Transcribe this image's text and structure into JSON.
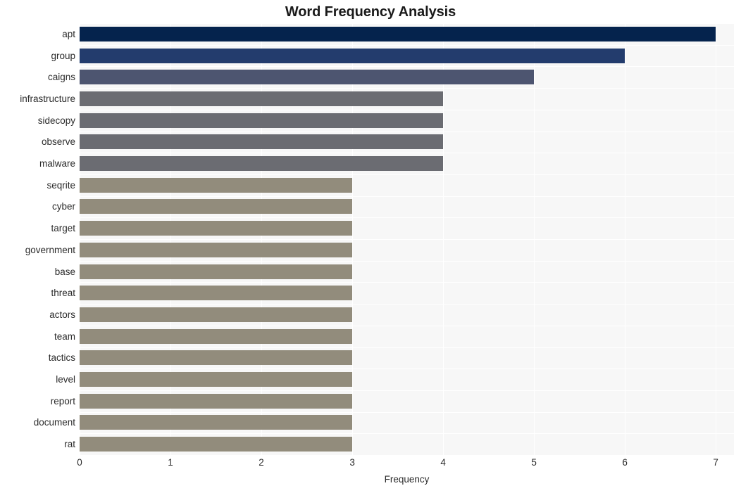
{
  "chart_data": {
    "type": "bar",
    "orientation": "horizontal",
    "title": "Word Frequency Analysis",
    "xlabel": "Frequency",
    "ylabel": "",
    "xlim": [
      0,
      7.2
    ],
    "xticks": [
      0,
      1,
      2,
      3,
      4,
      5,
      6,
      7
    ],
    "xtick_labels": [
      "0",
      "1",
      "2",
      "3",
      "4",
      "5",
      "6",
      "7"
    ],
    "grid": true,
    "legend": null,
    "categories": [
      "apt",
      "group",
      "caigns",
      "infrastructure",
      "sidecopy",
      "observe",
      "malware",
      "seqrite",
      "cyber",
      "target",
      "government",
      "base",
      "threat",
      "actors",
      "team",
      "tactics",
      "level",
      "report",
      "document",
      "rat"
    ],
    "values": [
      7,
      6,
      5,
      4,
      4,
      4,
      4,
      3,
      3,
      3,
      3,
      3,
      3,
      3,
      3,
      3,
      3,
      3,
      3,
      3
    ],
    "bar_colors": [
      "#05234d",
      "#233c6d",
      "#4d5570",
      "#6b6c72",
      "#6b6c72",
      "#6b6c72",
      "#6b6c72",
      "#928c7c",
      "#928c7c",
      "#928c7c",
      "#928c7c",
      "#928c7c",
      "#928c7c",
      "#928c7c",
      "#928c7c",
      "#928c7c",
      "#928c7c",
      "#928c7c",
      "#928c7c",
      "#928c7c"
    ]
  },
  "style": {
    "plot_background": "#f7f7f7",
    "page_background": "#ffffff",
    "gridline_color": "#ffffff",
    "text_color": "#2b2b2b",
    "title_color": "#1a1a1a"
  }
}
